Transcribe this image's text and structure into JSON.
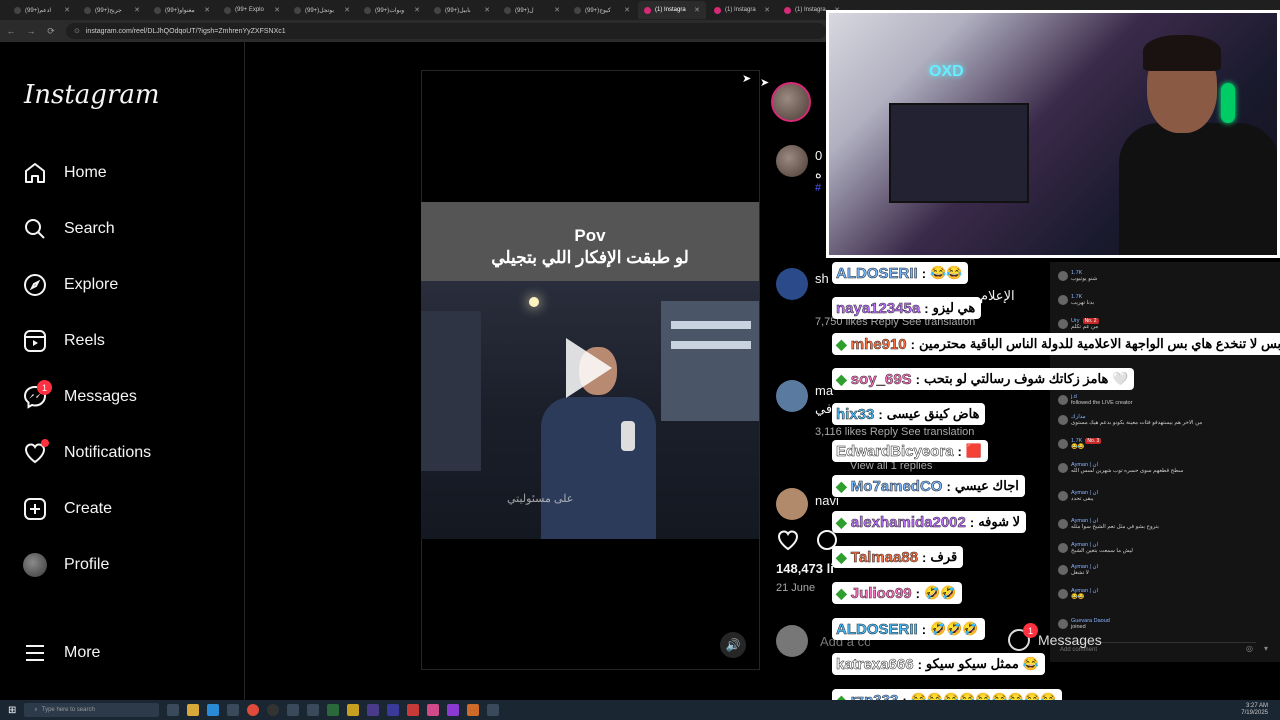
{
  "browser": {
    "tabs": [
      {
        "label": "(99+)ادعم"
      },
      {
        "label": "(99+)جريح"
      },
      {
        "label": "(99+)مغنواو"
      },
      {
        "label": "(99+ Explo"
      },
      {
        "label": "(99+)بوتجل"
      },
      {
        "label": "(99+)وبوات"
      },
      {
        "label": "(99+)بابيل"
      },
      {
        "label": "(99+)ل"
      },
      {
        "label": "(99+)كيوج"
      },
      {
        "label": "(1) Instagra"
      },
      {
        "label": "(1) Instagra"
      },
      {
        "label": "(1) Instagra"
      }
    ],
    "url": "instagram.com/reel/DLJhQOdqoUT/?igsh=ZmhrenYyZXFSNXc1"
  },
  "sidebar": {
    "logo": "Instagram",
    "items": [
      {
        "label": "Home",
        "icon": "home-icon"
      },
      {
        "label": "Search",
        "icon": "search-icon"
      },
      {
        "label": "Explore",
        "icon": "compass-icon"
      },
      {
        "label": "Reels",
        "icon": "reels-icon"
      },
      {
        "label": "Messages",
        "icon": "messenger-icon",
        "badge": "1"
      },
      {
        "label": "Notifications",
        "icon": "heart-icon"
      },
      {
        "label": "Create",
        "icon": "plus-square-icon"
      },
      {
        "label": "Profile",
        "icon": "avatar"
      }
    ],
    "more_label": "More"
  },
  "reel": {
    "title_en": "Pov",
    "title_ar": "لو طبقت الإفكار اللي بتجيلي",
    "channel_logo": "على مسئوليتي",
    "likes": "148,473 li",
    "date": "21 June",
    "add_comment": "Add a comment..."
  },
  "comments_partial": [
    {
      "user": "0",
      "text": "ه",
      "meta": "#"
    },
    {
      "user": "sh",
      "text": "الإعلام",
      "meta": "7,750 likes   Reply   See translation"
    },
    {
      "user": "ma",
      "text": "في",
      "meta": "3,116 likes   Reply   See translation"
    },
    {
      "user": "navi",
      "text": "",
      "meta": "View all 1 replies"
    }
  ],
  "overlay_chat": [
    {
      "user": "ALDOSERII",
      "text": "😂😂",
      "gem": false
    },
    {
      "user": "naya12345a",
      "text": "هي ليزو",
      "gem": false
    },
    {
      "user": "mhe910",
      "text": "بس لا تنخدع هاي بس الواجهة الاعلامية للدولة الناس الباقية محترمين",
      "gem": true
    },
    {
      "user": "soy_69S",
      "text": "هامز زكاتك شوف رسالتي لو بتحب 🤍",
      "gem": true
    },
    {
      "user": "hix33",
      "text": "هاض كينق عيسى",
      "gem": false
    },
    {
      "user": "EdwardBicyeora",
      "text": "🟥",
      "gem": false
    },
    {
      "user": "Mo7amedCO",
      "text": "اجاك عيسي",
      "gem": true
    },
    {
      "user": "alexhamida2002",
      "text": "لا شوفه",
      "gem": true
    },
    {
      "user": "Talmaa88",
      "text": "قرف",
      "gem": true
    },
    {
      "user": "Julioo99",
      "text": "🤣🤣",
      "gem": true
    },
    {
      "user": "ALDOSERII",
      "text": "🤣🤣🤣",
      "gem": false
    },
    {
      "user": "katrexa666",
      "text": "ممثل سيكو سيكو 😂",
      "gem": false
    },
    {
      "user": "rzn333",
      "text": "😂😂😂😂😂😂😂😂😂",
      "gem": true
    }
  ],
  "tiktok_panel": {
    "rows": [
      {
        "name": "1.7K",
        "text": "شنو يوتيوب"
      },
      {
        "name": "1.7K",
        "text": "بدنا تهريب"
      },
      {
        "name": "Ury",
        "badge": "No. 2",
        "text": "من عم تكلم"
      },
      {
        "name": "",
        "text": "كيف حالك"
      },
      {
        "name": "j.d",
        "text": "followed the LIVE creator"
      },
      {
        "name": "مدارك",
        "text": "من الاخر هم بيستهدفو فئات معينة بكونو بدعم هيك مستوى"
      },
      {
        "name": "1.7K",
        "badge": "No. 3",
        "text": "😂😂"
      },
      {
        "name": "Ayman | ان",
        "text": "سطح قطعهم سوى حسره توب شهرين لسس الله"
      },
      {
        "name": "Ayman | ان",
        "text": "يبقى تحدد"
      },
      {
        "name": "Ayman | ان",
        "text": "بتروح بشو في مثل تعم الشيخ سوا مثله"
      },
      {
        "name": "Ayman | ان",
        "text": "ليش ما سمعت بتعين الشيخ"
      },
      {
        "name": "Ayman | ان",
        "text": "لا تشغل"
      },
      {
        "name": "Ayman | ان",
        "text": "😂😂"
      },
      {
        "name": "Guevara Daoud",
        "text": "joined"
      }
    ],
    "comment_placeholder": "Add comment",
    "messages_label": "Messages",
    "messages_badge": "1"
  },
  "taskbar": {
    "search": "Type here to search",
    "time": "3:27 AM",
    "date": "7/19/2025"
  },
  "webcam": {
    "neon_sign": "OXD"
  },
  "colors": {
    "ig_badge": "#ff3040",
    "gem_green": "#2e9e2e"
  }
}
